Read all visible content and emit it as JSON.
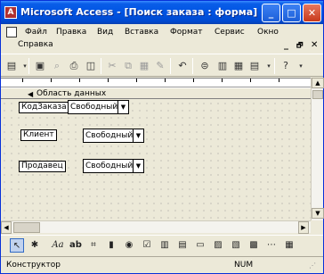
{
  "window": {
    "title": "Microsoft Access - [Поиск заказа : форма]",
    "app_icon_glyph": "A",
    "controls": {
      "minimize": "_",
      "maximize": "□",
      "close": "✕"
    }
  },
  "menu": {
    "items": [
      "Файл",
      "Правка",
      "Вид",
      "Вставка",
      "Формат",
      "Сервис",
      "Окно"
    ],
    "second_row": "Справка",
    "mdi_controls": {
      "minimize": "_",
      "restore": "🗗",
      "close": "✕"
    }
  },
  "form": {
    "section_label": "Область данных",
    "fields": [
      {
        "label": "КодЗаказа",
        "value": "Свободный"
      },
      {
        "label": "Клиент",
        "value": "Свободный"
      },
      {
        "label": "Продавец",
        "value": "Свободный"
      }
    ],
    "dropdown_glyph": "▼"
  },
  "statusbar": {
    "mode": "Конструктор",
    "num": "NUM"
  },
  "toolbar_icons": [
    "view-icon",
    "save-icon",
    "print-icon",
    "print-preview-icon",
    "cut-icon",
    "copy-icon",
    "paste-icon",
    "format-painter-icon",
    "undo-icon",
    "field-list-icon",
    "toolbox-icon",
    "autoformat-icon",
    "properties-icon",
    "help-icon"
  ],
  "toolbox_icons": [
    "select-objects-icon",
    "control-wizards-icon",
    "label-icon",
    "textbox-icon",
    "option-group-icon",
    "toggle-button-icon",
    "option-button-icon",
    "checkbox-icon",
    "combobox-icon",
    "listbox-icon",
    "command-button-icon",
    "image-icon",
    "unbound-object-icon",
    "bound-object-icon",
    "page-break-icon",
    "tab-control-icon"
  ]
}
